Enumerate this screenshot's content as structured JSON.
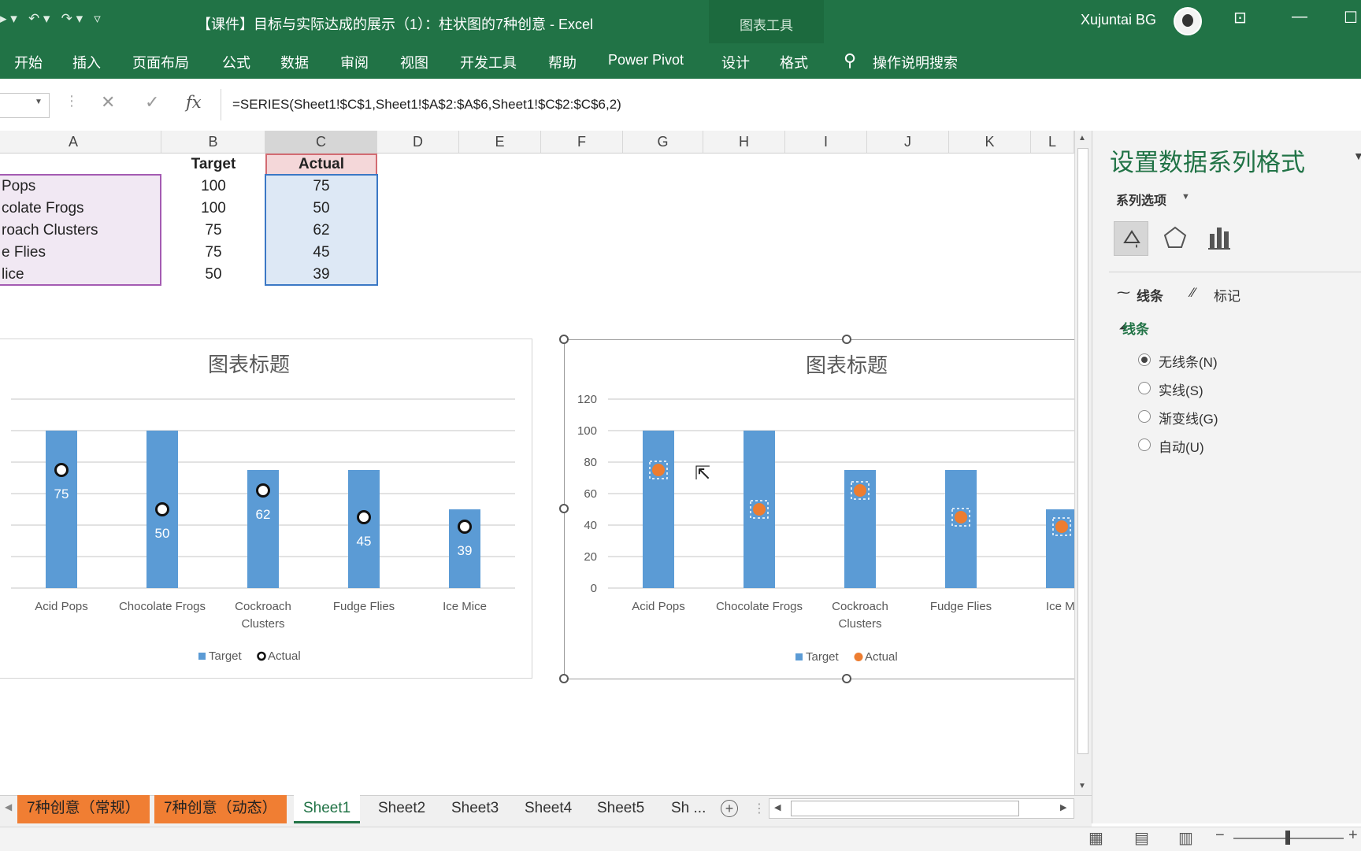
{
  "title_bar": {
    "doc_title": "【课件】目标与实际达成的展示（1）：柱状图的7种创意 - Excel",
    "context_tool": "图表工具",
    "user_name": "Xujuntai BG"
  },
  "ribbon": {
    "tabs": [
      "开始",
      "插入",
      "页面布局",
      "公式",
      "数据",
      "审阅",
      "视图",
      "开发工具",
      "帮助",
      "Power Pivot",
      "设计",
      "格式"
    ],
    "search_placeholder": "操作说明搜索"
  },
  "formula_bar": {
    "formula": "=SERIES(Sheet1!$C$1,Sheet1!$A$2:$A$6,Sheet1!$C$2:$C$6,2)"
  },
  "columns": [
    "A",
    "B",
    "C",
    "D",
    "E",
    "F",
    "G",
    "H",
    "I",
    "J",
    "K",
    "L"
  ],
  "sheet": {
    "header_row": {
      "a": "",
      "b": "Target",
      "c": "Actual"
    },
    "rows": [
      {
        "a": "Pops",
        "b": "100",
        "c": "75"
      },
      {
        "a": "colate Frogs",
        "b": "100",
        "c": "50"
      },
      {
        "a": "roach Clusters",
        "b": "75",
        "c": "62"
      },
      {
        "a": "e Flies",
        "b": "75",
        "c": "45"
      },
      {
        "a": "lice",
        "b": "50",
        "c": "39"
      }
    ]
  },
  "chart_data": [
    {
      "type": "bar",
      "title": "图表标题",
      "categories": [
        "Acid Pops",
        "Chocolate Frogs",
        "Cockroach Clusters",
        "Fudge Flies",
        "Ice Mice"
      ],
      "series": [
        {
          "name": "Target",
          "type": "bar",
          "values": [
            100,
            100,
            75,
            75,
            50
          ]
        },
        {
          "name": "Actual",
          "type": "marker",
          "values": [
            75,
            50,
            62,
            45,
            39
          ]
        }
      ],
      "data_labels": [
        75,
        50,
        62,
        45,
        39
      ],
      "ylim": [
        0,
        120
      ],
      "grid": true,
      "legend": "bottom",
      "colors": {
        "Target": "#5b9bd5",
        "Actual": "#ffffff"
      }
    },
    {
      "type": "bar",
      "title": "图表标题",
      "categories": [
        "Acid Pops",
        "Chocolate Frogs",
        "Cockroach Clusters",
        "Fudge Flies",
        "Ice Mi"
      ],
      "series": [
        {
          "name": "Target",
          "type": "bar",
          "values": [
            100,
            100,
            75,
            75,
            50
          ]
        },
        {
          "name": "Actual",
          "type": "marker",
          "values": [
            75,
            50,
            62,
            45,
            39
          ]
        }
      ],
      "yticks": [
        "0",
        "20",
        "40",
        "60",
        "80",
        "100",
        "120"
      ],
      "ylim": [
        0,
        120
      ],
      "grid": true,
      "legend": "bottom",
      "colors": {
        "Target": "#5b9bd5",
        "Actual": "#ed7d31"
      }
    }
  ],
  "pane": {
    "title": "设置数据系列格式",
    "series_options": "系列选项",
    "subtab_line": "线条",
    "subtab_marker": "标记",
    "section": "线条",
    "options": [
      "无线条(N)",
      "实线(S)",
      "渐变线(G)",
      "自动(U)"
    ],
    "selected_option": "无线条(N)"
  },
  "sheet_tabs": [
    "7种创意（常规）",
    "7种创意（动态）",
    "Sheet1",
    "Sheet2",
    "Sheet3",
    "Sheet4",
    "Sheet5",
    "Sh ..."
  ],
  "active_sheet": "Sheet1"
}
